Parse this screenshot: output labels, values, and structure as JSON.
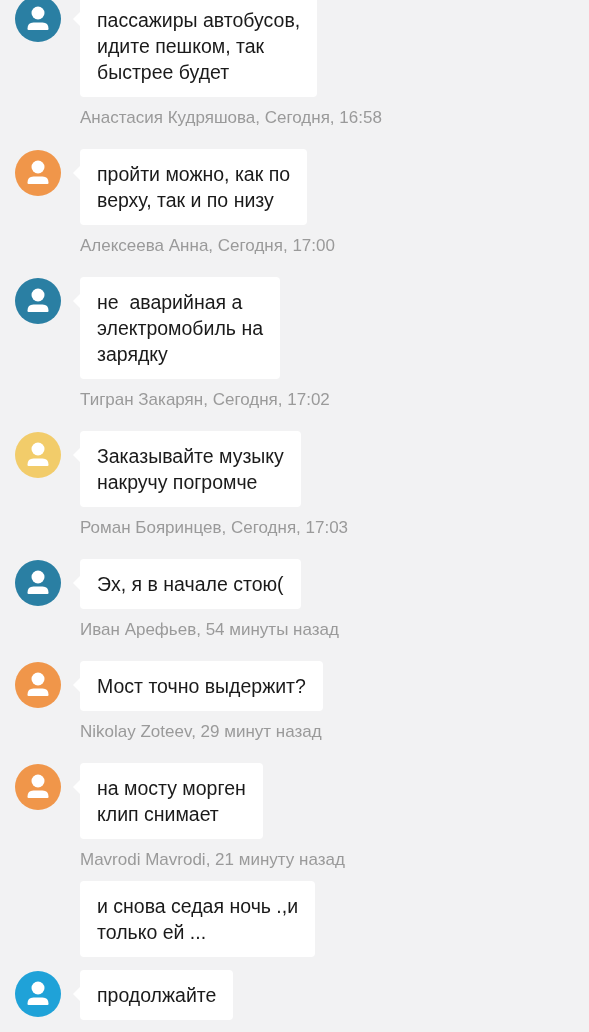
{
  "messages": [
    {
      "color": "#2a7fa3",
      "text": "пассажиры автобусов,\nидите пешком, так\nбыстрее будет",
      "meta": "Анастасия Кудряшова, Сегодня, 16:58"
    },
    {
      "color": "#f0964a",
      "text": "пройти можно, как по\nверху, так и по низу",
      "meta": "Алексеева Анна, Сегодня, 17:00"
    },
    {
      "color": "#2a7fa3",
      "text": "не  аварийная а\nэлектромобиль на\nзарядку",
      "meta": "Тигран Закарян, Сегодня, 17:02"
    },
    {
      "color": "#f2cc6a",
      "text": "Заказывайте музыку\nнакручу погромче",
      "meta": "Роман Бояринцев, Сегодня, 17:03"
    },
    {
      "color": "#2a7fa3",
      "text": "Эх, я в начале стою(",
      "meta": "Иван Арефьев, 54 минуты назад"
    },
    {
      "color": "#f0964a",
      "text": "Мост точно выдержит?",
      "meta": "Nikolay Zoteev, 29 минут назад"
    },
    {
      "color": "#f0964a",
      "text": "на мосту морген\nклип снимает",
      "meta": "Mavrodi Mavrodi, 21 минуту назад"
    },
    {
      "text": "и снова седая ночь .,и\nтолько ей ..."
    },
    {
      "color": "#1fa2d8",
      "text": "продолжайте"
    }
  ]
}
